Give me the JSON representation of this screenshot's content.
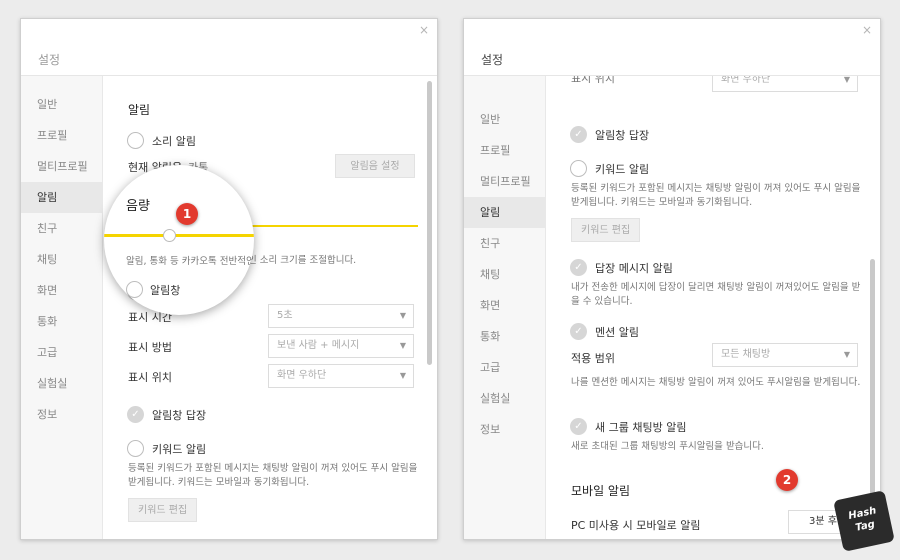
{
  "sidebar_items": [
    "일반",
    "프로필",
    "멀티프로필",
    "알림",
    "친구",
    "채팅",
    "화면",
    "통화",
    "고급",
    "실험실",
    "정보"
  ],
  "left_window": {
    "title": "설정",
    "close_icon": "×",
    "alarm_title": "알림",
    "sound_alarm": "소리 알림",
    "current_sound_label": "현재 알림음",
    "current_sound_value": "카톡",
    "sound_setting_button": "알림음 설정",
    "volume_title": "음량",
    "volume_level": 0.35,
    "volume_desc": "알림, 통화 등 카카오톡 전반적인 소리 크기를 조절합니다.",
    "popup": "알림창",
    "display_time_label": "표시 시간",
    "display_time_value": "5초",
    "display_method_label": "표시 방법",
    "display_method_value": "보낸 사람 + 메시지",
    "display_position_label": "표시 위치",
    "display_position_value": "화면 우하단",
    "popup_reply": "알림창 답장",
    "keyword_alarm": "키워드 알림",
    "keyword_desc": "등록된 키워드가 포함된 메시지는 채팅방 알림이 꺼져 있어도 푸시 알림을 받게됩니다. 키워드는 모바일과 동기화됩니다.",
    "keyword_edit_button": "키워드 편집",
    "badge": "1"
  },
  "right_window": {
    "title": "설정",
    "close_icon": "×",
    "display_position_label": "표시 위치",
    "display_position_value": "화면 우하단",
    "popup_reply": "알림창 답장",
    "keyword_alarm": "키워드 알림",
    "keyword_desc": "등록된 키워드가 포함된 메시지는 채팅방 알림이 꺼져 있어도 푸시 알림을 받게됩니다. 키워드는 모바일과 동기화됩니다.",
    "keyword_edit_button": "키워드 편집",
    "reply_alarm": "답장 메시지 알림",
    "reply_desc": "내가 전송한 메시지에 답장이 달리면 채팅방 알림이 꺼져있어도 알림을 받을 수 있습니다.",
    "mention_alarm": "멘션 알림",
    "apply_range_label": "적용 범위",
    "apply_range_value": "모든 채팅방",
    "mention_desc": "나를 멘션한 메시지는 채팅방 알림이 꺼져 있어도 푸시알림을 받게됩니다.",
    "group_alarm": "새 그룹 채팅방 알림",
    "group_desc": "새로 초대된 그룹 채팅방의 푸시알림을 받습니다.",
    "mobile_title": "모바일 알림",
    "pc_unused_label": "PC 미사용 시 모바일로 알림",
    "pc_unused_value": "3분 후",
    "badge": "2"
  },
  "logo": {
    "line1": "Hash",
    "line2": "Tag"
  },
  "colors": {
    "accent": "#f5d400",
    "badge": "#e23a2e",
    "check": "#d6d6d6"
  }
}
